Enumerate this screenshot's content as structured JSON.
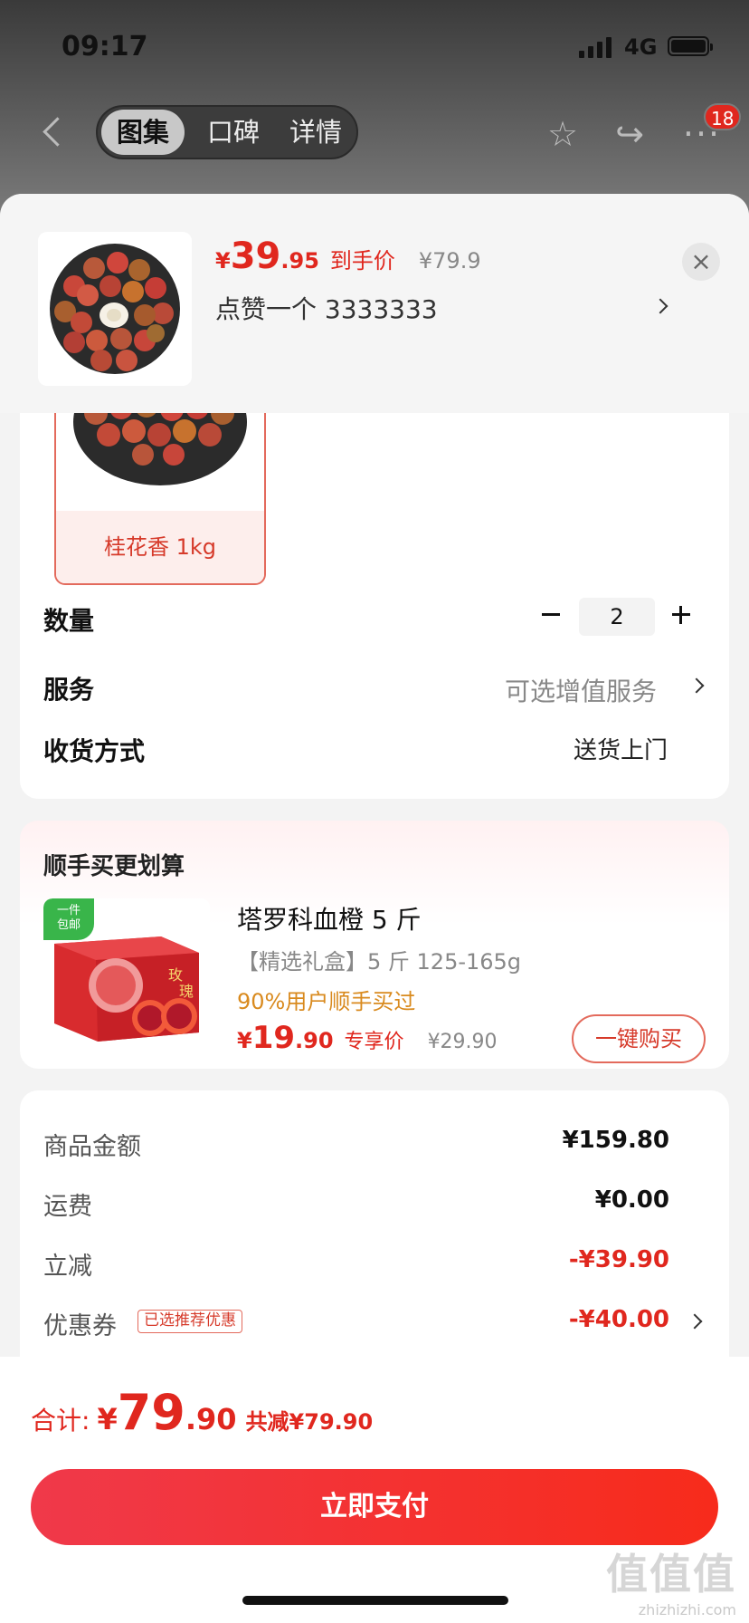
{
  "status_bar": {
    "time": "09:17",
    "network": "4G"
  },
  "nav": {
    "tabs": [
      {
        "label": "图集",
        "active": true
      },
      {
        "label": "口碑",
        "active": false
      },
      {
        "label": "详情",
        "active": false
      }
    ],
    "more_badge": "18"
  },
  "header": {
    "price_symbol": "¥",
    "price_int": "39",
    "price_dec": ".95",
    "price_tag": "到手价",
    "original_price": "¥79.9",
    "liked_text": "点赞一个  3333333",
    "close_glyph": "×"
  },
  "spec": {
    "label": "桂花香 1kg"
  },
  "options": {
    "quantity_label": "数量",
    "quantity_value": "2",
    "service_label": "服务",
    "service_value": "可选增值服务",
    "delivery_label": "收货方式",
    "delivery_value": "送货上门"
  },
  "upsell": {
    "title": "顺手买更划算",
    "free_tag": "一件\n包邮",
    "name": "塔罗科血橙 5 斤",
    "spec": "【精选礼盒】5 斤 125-165g",
    "social": "90%用户顺手买过",
    "price_symbol": "¥",
    "price_int": "19",
    "price_dec": ".90",
    "price_tag": "专享价",
    "original_price": "¥29.90",
    "buy_button": "一键购买"
  },
  "summary": {
    "items": [
      {
        "label": "商品金额",
        "value": "¥159.80",
        "red": false
      },
      {
        "label": "运费",
        "value": "¥0.00",
        "red": false
      },
      {
        "label": "立减",
        "value": "-¥39.90",
        "red": true
      },
      {
        "label": "优惠券",
        "value": "-¥40.00",
        "red": true
      }
    ],
    "coupon_tag": "已选推荐优惠"
  },
  "footer": {
    "total_label": "合计:",
    "total_symbol": "¥",
    "total_int": "79",
    "total_dec": ".90",
    "total_save": "共减¥79.90",
    "pay_button": "立即支付"
  },
  "watermark": {
    "big": "值值值",
    "small": "zhizhizhi.com"
  },
  "colors": {
    "accent": "#e0271e",
    "green_tag": "#39b54a",
    "social": "#d98a1e"
  }
}
